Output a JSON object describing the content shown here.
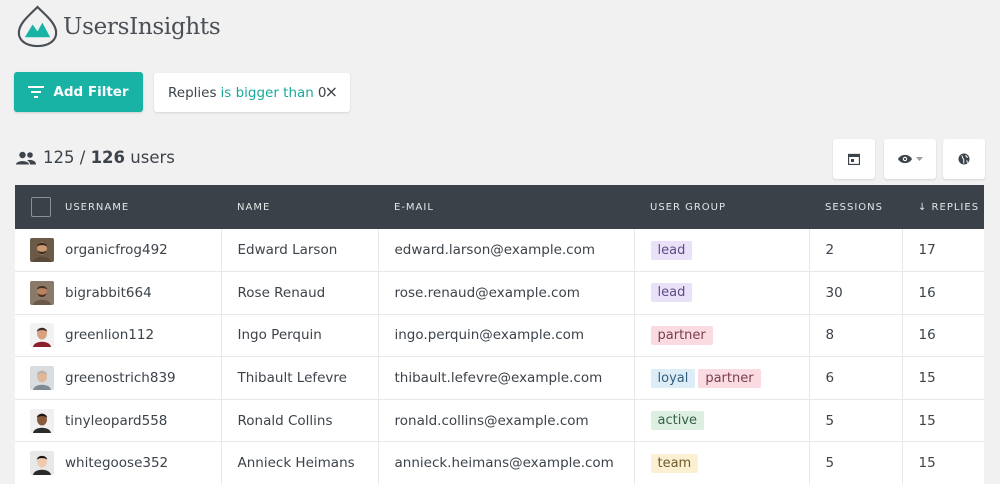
{
  "app": {
    "name": "UsersInsights"
  },
  "filters": {
    "add_filter_label": "Add Filter",
    "active": [
      {
        "field": "Replies",
        "operator": "is bigger than",
        "value": "0",
        "close": "×"
      }
    ]
  },
  "summary": {
    "shown": "125",
    "separator": "/",
    "total": "126",
    "unit": "users"
  },
  "toolbar_icons": [
    "calendar-icon",
    "eye-dropdown-icon",
    "globe-icon"
  ],
  "table": {
    "columns": [
      "USERNAME",
      "NAME",
      "E-MAIL",
      "USER GROUP",
      "SESSIONS",
      "↓ REPLIES"
    ],
    "rows": [
      {
        "username": "organicfrog492",
        "name": "Edward Larson",
        "email": "edward.larson@example.com",
        "groups": [
          "lead"
        ],
        "sessions": "2",
        "replies": "17"
      },
      {
        "username": "bigrabbit664",
        "name": "Rose Renaud",
        "email": "rose.renaud@example.com",
        "groups": [
          "lead"
        ],
        "sessions": "30",
        "replies": "16"
      },
      {
        "username": "greenlion112",
        "name": "Ingo Perquin",
        "email": "ingo.perquin@example.com",
        "groups": [
          "partner"
        ],
        "sessions": "8",
        "replies": "16"
      },
      {
        "username": "greenostrich839",
        "name": "Thibault Lefevre",
        "email": "thibault.lefevre@example.com",
        "groups": [
          "loyal",
          "partner"
        ],
        "sessions": "6",
        "replies": "15"
      },
      {
        "username": "tinyleopard558",
        "name": "Ronald Collins",
        "email": "ronald.collins@example.com",
        "groups": [
          "active"
        ],
        "sessions": "5",
        "replies": "15"
      },
      {
        "username": "whitegoose352",
        "name": "Annieck Heimans",
        "email": "annieck.heimans@example.com",
        "groups": [
          "team"
        ],
        "sessions": "5",
        "replies": "15"
      }
    ]
  },
  "colors": {
    "accent": "#19b3a5",
    "table_header": "#3b4148",
    "background": "#f1f1f1"
  }
}
